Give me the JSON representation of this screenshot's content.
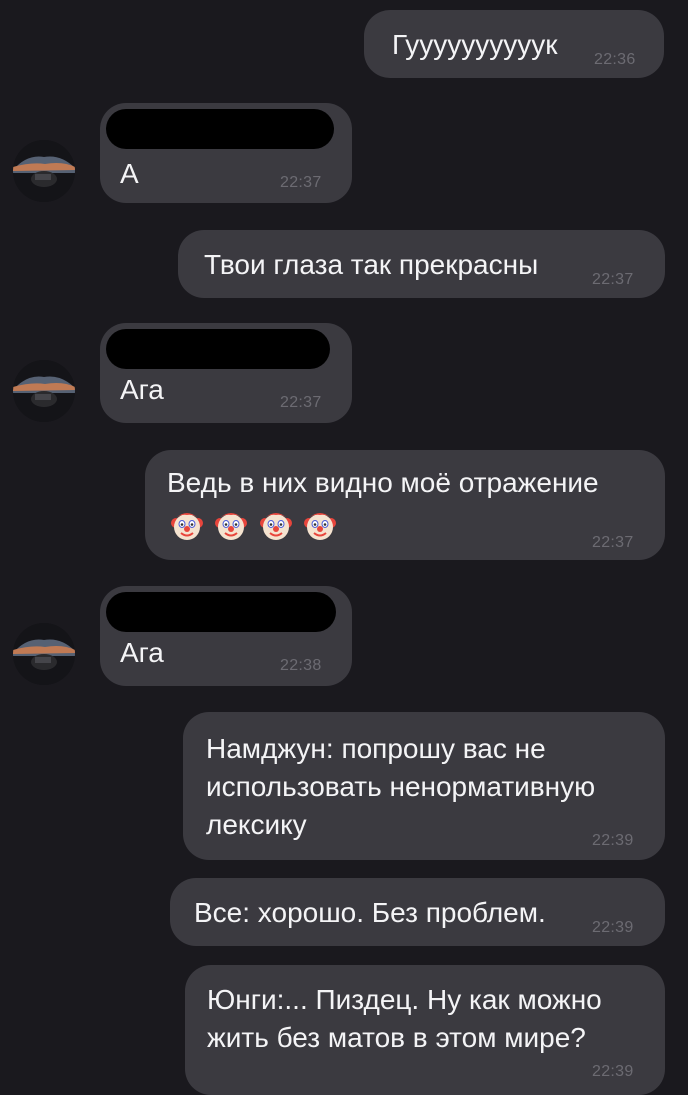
{
  "messages": [
    {
      "id": "m1",
      "side": "out",
      "text": "Гуууууууууук",
      "time": "22:36"
    },
    {
      "id": "m2",
      "side": "in",
      "text": "А",
      "time": "22:37"
    },
    {
      "id": "m3",
      "side": "out",
      "text": "Твои глаза так прекрасны",
      "time": "22:37"
    },
    {
      "id": "m4",
      "side": "in",
      "text": "Ага",
      "time": "22:37"
    },
    {
      "id": "m5",
      "side": "out",
      "text": "Ведь в них видно моё отражение",
      "emoji": [
        "clown-face",
        "clown-face",
        "clown-face",
        "clown-face"
      ],
      "time": "22:37"
    },
    {
      "id": "m6",
      "side": "in",
      "text": "Ага",
      "time": "22:38"
    },
    {
      "id": "m7",
      "side": "out",
      "lines": [
        "Намджун: попрошу вас не",
        "использовать ненормативную",
        "лексику"
      ],
      "time": "22:39"
    },
    {
      "id": "m8",
      "side": "out",
      "text": "Все: хорошо. Без проблем.",
      "time": "22:39"
    },
    {
      "id": "m9",
      "side": "out",
      "lines": [
        "Юнги:... Пиздец. Ну как можно",
        "жить без матов в этом мире?"
      ],
      "time": "22:39"
    }
  ],
  "colors": {
    "background": "#1a191e",
    "bubble": "#3b3a40",
    "text": "#f4f4f6",
    "time": "#6c6b72",
    "redaction": "#000000"
  }
}
